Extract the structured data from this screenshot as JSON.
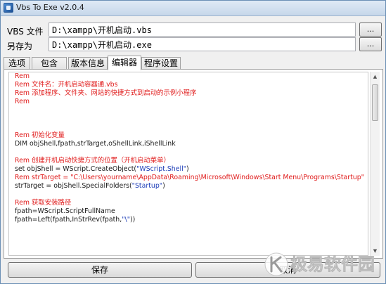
{
  "window": {
    "title": "Vbs To Exe v2.0.4"
  },
  "form": {
    "vbs_label": "VBS 文件",
    "vbs_value": "D:\\xampp\\开机启动.vbs",
    "saveas_label": "另存为",
    "saveas_value": "D:\\xampp\\开机启动.exe",
    "browse_label": "..."
  },
  "tabs": [
    {
      "label": "选项",
      "active": false
    },
    {
      "label": "包含",
      "active": false
    },
    {
      "label": "版本信息",
      "active": false
    },
    {
      "label": "编辑器",
      "active": true
    },
    {
      "label": "程序设置",
      "active": false
    }
  ],
  "editor": {
    "lines": [
      {
        "type": "comment",
        "text": "Rem"
      },
      {
        "type": "comment",
        "text": "Rem 文件名：开机启动容器通.vbs"
      },
      {
        "type": "comment",
        "text": "Rem 添加程序、文件夹、网站的快捷方式到启动的示例小程序"
      },
      {
        "type": "comment",
        "text": "Rem"
      },
      {
        "type": "blank",
        "text": ""
      },
      {
        "type": "blank",
        "text": ""
      },
      {
        "type": "blank",
        "text": ""
      },
      {
        "type": "comment",
        "text": "Rem 初始化变量"
      },
      {
        "type": "code",
        "text": "DIM objShell,fpath,strTarget,oShellLink,iShellLink"
      },
      {
        "type": "blank",
        "text": ""
      },
      {
        "type": "comment",
        "text": "Rem 创建开机启动快捷方式的位置（开机启动菜单）"
      },
      {
        "type": "mixed",
        "parts": [
          {
            "c": "code",
            "t": "set objShell = WScript.CreateObject("
          },
          {
            "c": "string",
            "t": "\"WScript.Shell\""
          },
          {
            "c": "code",
            "t": ")"
          }
        ]
      },
      {
        "type": "comment",
        "text": "Rem strTarget = \"C:\\Users\\yourname\\AppData\\Roaming\\Microsoft\\Windows\\Start Menu\\Programs\\Startup\""
      },
      {
        "type": "mixed",
        "parts": [
          {
            "c": "code",
            "t": "strTarget = objShell.SpecialFolders("
          },
          {
            "c": "string",
            "t": "\"Startup\""
          },
          {
            "c": "code",
            "t": ")"
          }
        ]
      },
      {
        "type": "blank",
        "text": ""
      },
      {
        "type": "comment",
        "text": "Rem 获取安装路径"
      },
      {
        "type": "code",
        "text": "fpath=WScript.ScriptFullName"
      },
      {
        "type": "mixed",
        "parts": [
          {
            "c": "code",
            "t": "fpath=Left(fpath,InStrRev(fpath,"
          },
          {
            "c": "string",
            "t": "\"\\\""
          },
          {
            "c": "code",
            "t": "))"
          }
        ]
      }
    ]
  },
  "buttons": {
    "save": "保存",
    "cancel": "取消"
  },
  "watermark": {
    "text": "极易软件园"
  },
  "colors": {
    "comment": "#e01b1b",
    "string": "#1f3fb8",
    "code": "#1a1a1a"
  }
}
